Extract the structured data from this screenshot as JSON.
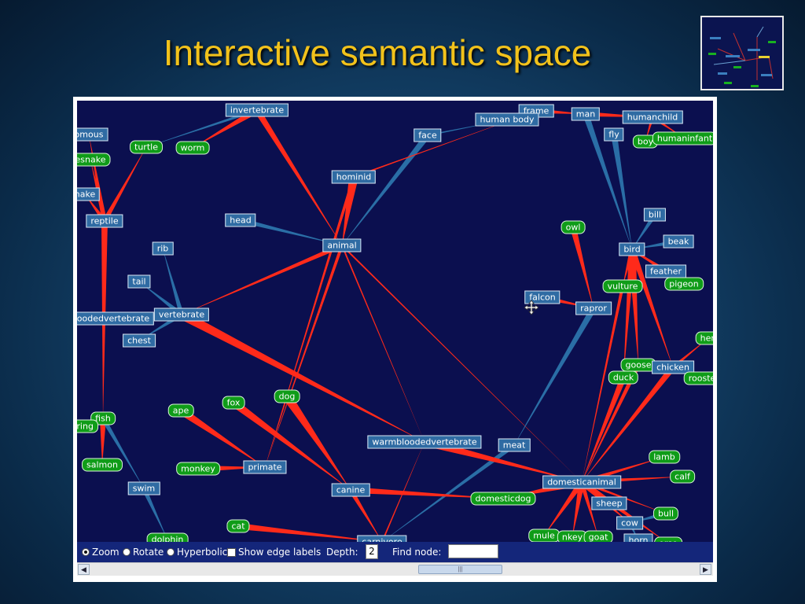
{
  "slide": {
    "title": "Interactive semantic space"
  },
  "colors": {
    "canvas_bg": "#0b0f4f",
    "edge_red": "#ff2a1a",
    "edge_blue": "#2a6ea6",
    "concept_node": "#2f6ba3",
    "word_node": "#0f9c18",
    "title": "#f2c21b"
  },
  "graph": {
    "nodes": [
      {
        "id": "invertebrate",
        "label": "invertebrate",
        "kind": "concept"
      },
      {
        "id": "frame",
        "label": "frame",
        "kind": "concept"
      },
      {
        "id": "human_body",
        "label": "human body",
        "kind": "concept"
      },
      {
        "id": "man",
        "label": "man",
        "kind": "concept"
      },
      {
        "id": "humanchild",
        "label": "humanchild",
        "kind": "concept"
      },
      {
        "id": "face",
        "label": "face",
        "kind": "concept"
      },
      {
        "id": "fly",
        "label": "fly",
        "kind": "concept"
      },
      {
        "id": "boy",
        "label": "boy",
        "kind": "word"
      },
      {
        "id": "humaninfant",
        "label": "humaninfant",
        "kind": "word"
      },
      {
        "id": "venomous",
        "label": "omous",
        "kind": "concept"
      },
      {
        "id": "turtle",
        "label": "turtle",
        "kind": "word"
      },
      {
        "id": "worm",
        "label": "worm",
        "kind": "word"
      },
      {
        "id": "rattlesnake",
        "label": "esnake",
        "kind": "word"
      },
      {
        "id": "hominid",
        "label": "hominid",
        "kind": "concept"
      },
      {
        "id": "snake",
        "label": "nake",
        "kind": "concept"
      },
      {
        "id": "bill",
        "label": "bill",
        "kind": "concept"
      },
      {
        "id": "reptile",
        "label": "reptile",
        "kind": "concept"
      },
      {
        "id": "head",
        "label": "head",
        "kind": "concept"
      },
      {
        "id": "owl",
        "label": "owl",
        "kind": "word"
      },
      {
        "id": "beak",
        "label": "beak",
        "kind": "concept"
      },
      {
        "id": "animal",
        "label": "animal",
        "kind": "concept"
      },
      {
        "id": "rib",
        "label": "rib",
        "kind": "concept"
      },
      {
        "id": "bird",
        "label": "bird",
        "kind": "concept"
      },
      {
        "id": "feather",
        "label": "feather",
        "kind": "concept"
      },
      {
        "id": "tail",
        "label": "tail",
        "kind": "concept"
      },
      {
        "id": "vulture",
        "label": "vulture",
        "kind": "word"
      },
      {
        "id": "pigeon",
        "label": "pigeon",
        "kind": "word"
      },
      {
        "id": "falcon",
        "label": "falcon",
        "kind": "concept"
      },
      {
        "id": "raptor",
        "label": "rapror",
        "kind": "concept"
      },
      {
        "id": "vertebrate",
        "label": "vertebrate",
        "kind": "concept"
      },
      {
        "id": "coldblooded",
        "label": "oodedvertebrate",
        "kind": "concept"
      },
      {
        "id": "chest",
        "label": "chest",
        "kind": "concept"
      },
      {
        "id": "hen",
        "label": "hen",
        "kind": "word"
      },
      {
        "id": "goose",
        "label": "goose",
        "kind": "word"
      },
      {
        "id": "chicken",
        "label": "chicken",
        "kind": "concept"
      },
      {
        "id": "duck",
        "label": "duck",
        "kind": "word"
      },
      {
        "id": "rooster",
        "label": "rooste",
        "kind": "word"
      },
      {
        "id": "dog",
        "label": "dog",
        "kind": "word"
      },
      {
        "id": "fox",
        "label": "fox",
        "kind": "word"
      },
      {
        "id": "ape",
        "label": "ape",
        "kind": "word"
      },
      {
        "id": "fish",
        "label": "fish",
        "kind": "word"
      },
      {
        "id": "herring",
        "label": "rring",
        "kind": "word"
      },
      {
        "id": "warmblooded",
        "label": "warmbloodedvertebrate",
        "kind": "concept"
      },
      {
        "id": "meat",
        "label": "meat",
        "kind": "concept"
      },
      {
        "id": "lamb",
        "label": "lamb",
        "kind": "word"
      },
      {
        "id": "salmon",
        "label": "salmon",
        "kind": "word"
      },
      {
        "id": "monkey",
        "label": "monkey",
        "kind": "word"
      },
      {
        "id": "primate",
        "label": "primate",
        "kind": "concept"
      },
      {
        "id": "calf",
        "label": "calf",
        "kind": "word"
      },
      {
        "id": "domesticanimal",
        "label": "domesticanimal",
        "kind": "concept"
      },
      {
        "id": "swim",
        "label": "swim",
        "kind": "concept"
      },
      {
        "id": "canine",
        "label": "canine",
        "kind": "concept"
      },
      {
        "id": "domesticdog",
        "label": "domesticdog",
        "kind": "word"
      },
      {
        "id": "sheep",
        "label": "sheep",
        "kind": "concept"
      },
      {
        "id": "bull",
        "label": "bull",
        "kind": "word"
      },
      {
        "id": "cat",
        "label": "cat",
        "kind": "word"
      },
      {
        "id": "cow",
        "label": "cow",
        "kind": "concept"
      },
      {
        "id": "mule",
        "label": "mule",
        "kind": "word"
      },
      {
        "id": "donkey",
        "label": "nkey",
        "kind": "word"
      },
      {
        "id": "goat",
        "label": "goat",
        "kind": "word"
      },
      {
        "id": "horn",
        "label": "horn",
        "kind": "concept"
      },
      {
        "id": "dolphin",
        "label": "dolphin",
        "kind": "word"
      },
      {
        "id": "carnivore",
        "label": "carnivore",
        "kind": "concept"
      },
      {
        "id": "horse",
        "label": "orse",
        "kind": "word"
      }
    ],
    "edges": [
      [
        "hominid",
        "animal",
        "red",
        6
      ],
      [
        "invertebrate",
        "animal",
        "red",
        4
      ],
      [
        "face",
        "animal",
        "blue",
        4
      ],
      [
        "head",
        "animal",
        "blue",
        3
      ],
      [
        "animal",
        "vertebrate",
        "red",
        3
      ],
      [
        "animal",
        "primate",
        "red",
        2
      ],
      [
        "animal",
        "domesticanimal",
        "red",
        1
      ],
      [
        "animal",
        "warmblooded",
        "red",
        1
      ],
      [
        "hominid",
        "frame",
        "red",
        1
      ],
      [
        "man",
        "bird",
        "blue",
        4
      ],
      [
        "fly",
        "bird",
        "blue",
        4
      ],
      [
        "bill",
        "bird",
        "blue",
        3
      ],
      [
        "beak",
        "bird",
        "blue",
        3
      ],
      [
        "feather",
        "bird",
        "red",
        3
      ],
      [
        "bird",
        "pigeon",
        "red",
        2
      ],
      [
        "bird",
        "chicken",
        "red",
        4
      ],
      [
        "bird",
        "goose",
        "red",
        5
      ],
      [
        "bird",
        "duck",
        "red",
        4
      ],
      [
        "bird",
        "vulture",
        "red",
        3
      ],
      [
        "owl",
        "raptor",
        "red",
        4
      ],
      [
        "falcon",
        "raptor",
        "red",
        3
      ],
      [
        "raptor",
        "meat",
        "blue",
        4
      ],
      [
        "meat",
        "carnivore",
        "blue",
        3
      ],
      [
        "man",
        "humanchild",
        "red",
        3
      ],
      [
        "humanchild",
        "boy",
        "red",
        2
      ],
      [
        "humanchild",
        "humaninfant",
        "red",
        2
      ],
      [
        "frame",
        "man",
        "red",
        3
      ],
      [
        "chicken",
        "hen",
        "red",
        2
      ],
      [
        "chicken",
        "rooster",
        "red",
        3
      ],
      [
        "chicken",
        "domesticanimal",
        "red",
        4
      ],
      [
        "duck",
        "domesticanimal",
        "red",
        4
      ],
      [
        "goose",
        "domesticanimal",
        "red",
        3
      ],
      [
        "vulture",
        "domesticanimal",
        "red",
        2
      ],
      [
        "warmblooded",
        "domesticanimal",
        "red",
        5
      ],
      [
        "domesticanimal",
        "lamb",
        "red",
        3
      ],
      [
        "domesticanimal",
        "calf",
        "red",
        3
      ],
      [
        "domesticanimal",
        "sheep",
        "red",
        3
      ],
      [
        "domesticanimal",
        "cow",
        "red",
        4
      ],
      [
        "domesticanimal",
        "mule",
        "red",
        4
      ],
      [
        "domesticanimal",
        "donkey",
        "red",
        4
      ],
      [
        "domesticanimal",
        "goat",
        "red",
        3
      ],
      [
        "domesticanimal",
        "horse",
        "red",
        4
      ],
      [
        "domesticanimal",
        "domesticdog",
        "red",
        5
      ],
      [
        "domesticanimal",
        "bull",
        "red",
        2
      ],
      [
        "bull",
        "cow",
        "blue",
        3
      ],
      [
        "cow",
        "horn",
        "blue",
        2
      ],
      [
        "vertebrate",
        "warmblooded",
        "red",
        6
      ],
      [
        "vertebrate",
        "rib",
        "blue",
        3
      ],
      [
        "vertebrate",
        "tail",
        "blue",
        3
      ],
      [
        "vertebrate",
        "chest",
        "blue",
        3
      ],
      [
        "vertebrate",
        "coldblooded",
        "blue",
        3
      ],
      [
        "reptile",
        "turtle",
        "red",
        3
      ],
      [
        "reptile",
        "snake",
        "red",
        3
      ],
      [
        "reptile",
        "rattlesnake",
        "red",
        3
      ],
      [
        "reptile",
        "venomous",
        "red",
        3
      ],
      [
        "reptile",
        "fish",
        "red",
        4
      ],
      [
        "invertebrate",
        "worm",
        "red",
        4
      ],
      [
        "fish",
        "herring",
        "red",
        3
      ],
      [
        "fish",
        "salmon",
        "red",
        4
      ],
      [
        "fish",
        "swim",
        "blue",
        3
      ],
      [
        "swim",
        "dolphin",
        "blue",
        3
      ],
      [
        "dog",
        "canine",
        "red",
        6
      ],
      [
        "dog",
        "primate",
        "red",
        1
      ],
      [
        "fox",
        "canine",
        "red",
        5
      ],
      [
        "ape",
        "primate",
        "red",
        5
      ],
      [
        "monkey",
        "primate",
        "red",
        4
      ],
      [
        "canine",
        "domesticdog",
        "red",
        4
      ],
      [
        "canine",
        "carnivore",
        "red",
        3
      ],
      [
        "cat",
        "carnivore",
        "red",
        4
      ],
      [
        "carnivore",
        "warmblooded",
        "red",
        1
      ],
      [
        "hominid",
        "primate",
        "red",
        2
      ],
      [
        "invertebrate",
        "turtle",
        "blue",
        2
      ],
      [
        "face",
        "human_body",
        "blue",
        1
      ]
    ]
  },
  "controls": {
    "zoom_label": "Zoom",
    "rotate_label": "Rotate",
    "hyperbolic_label": "Hyperbolic",
    "edge_labels_label": "Show edge labels",
    "depth_label": "Depth:",
    "depth_value": "2",
    "find_label": "Find node:",
    "find_value": "",
    "selected_mode": "Zoom",
    "show_edge_labels": false
  }
}
